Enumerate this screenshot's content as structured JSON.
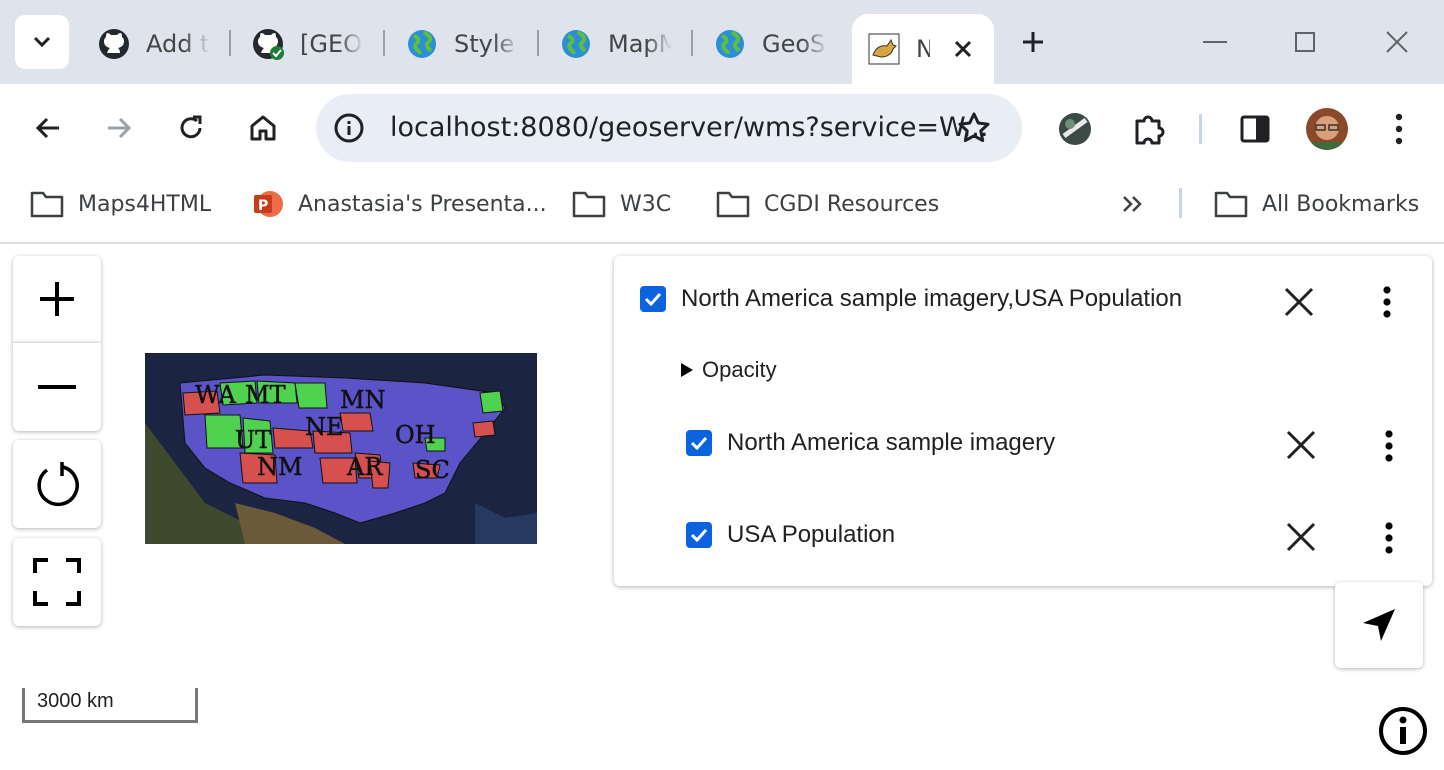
{
  "tabs": [
    {
      "title": "Add t",
      "icon": "github-icon"
    },
    {
      "title": "[GEOS",
      "icon": "github-verified-icon"
    },
    {
      "title": "Style (",
      "icon": "globe-icon"
    },
    {
      "title": "MapM",
      "icon": "globe-icon"
    },
    {
      "title": "GeoSe",
      "icon": "globe-icon"
    },
    {
      "title": "N",
      "icon": "tomcat-icon",
      "active": true
    }
  ],
  "address_bar": {
    "url": "localhost:8080/geoserver/wms?service=W..."
  },
  "bookmarks": [
    {
      "label": "Maps4HTML",
      "icon": "folder-icon"
    },
    {
      "label": "Anastasia's Presenta...",
      "icon": "powerpoint-icon"
    },
    {
      "label": "W3C",
      "icon": "folder-icon"
    },
    {
      "label": "CGDI Resources",
      "icon": "folder-icon"
    },
    {
      "label": "All Bookmarks",
      "icon": "folder-icon"
    }
  ],
  "map": {
    "scale_label": "3000 km",
    "state_labels": [
      "WA",
      "MT",
      "MN",
      "UT",
      "NE",
      "OH",
      "NM",
      "AR",
      "SC"
    ]
  },
  "layer_panel": {
    "group_label": "North America sample imagery,USA Population",
    "opacity_label": "Opacity",
    "layers": [
      {
        "label": "North America sample imagery",
        "checked": true
      },
      {
        "label": "USA Population",
        "checked": true
      }
    ]
  },
  "colors": {
    "checkbox": "#0b63e0",
    "tabstrip": "#dfe3eb",
    "omnibox": "#e9edf5"
  }
}
